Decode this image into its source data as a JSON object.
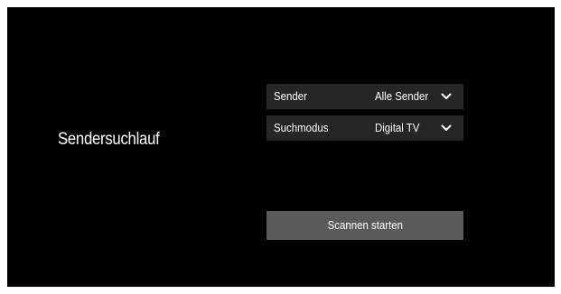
{
  "page": {
    "title": "Sendersuchlauf"
  },
  "settings": [
    {
      "label": "Sender",
      "value": "Alle Sender",
      "icon": "chevron-down-icon"
    },
    {
      "label": "Suchmodus",
      "value": "Digital TV",
      "icon": "chevron-down-icon"
    }
  ],
  "actions": {
    "scan_label": "Scannen starten"
  },
  "colors": {
    "background": "#000000",
    "row_background": "#262626",
    "button_background": "#5a5a5a",
    "text": "#ffffff"
  }
}
